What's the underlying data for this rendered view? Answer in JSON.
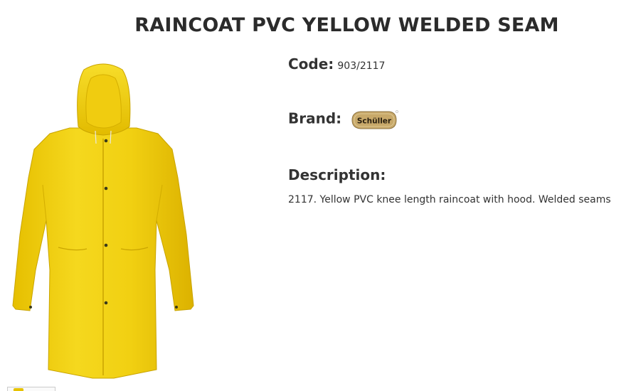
{
  "product": {
    "title": "RAINCOAT PVC YELLOW WELDED SEAM",
    "code_label": "Code:",
    "code_value": "903/2117",
    "brand_label": "Brand:",
    "brand_logo_text": "Schüller",
    "description_label": "Description:",
    "description_text": "2117. Yellow PVC knee length raincoat with hood. Welded seams"
  },
  "colors": {
    "coat_yellow": "#f2d21b",
    "coat_shadow": "#d9b400",
    "logo_bg": "#c8a96a",
    "text": "#333333"
  }
}
